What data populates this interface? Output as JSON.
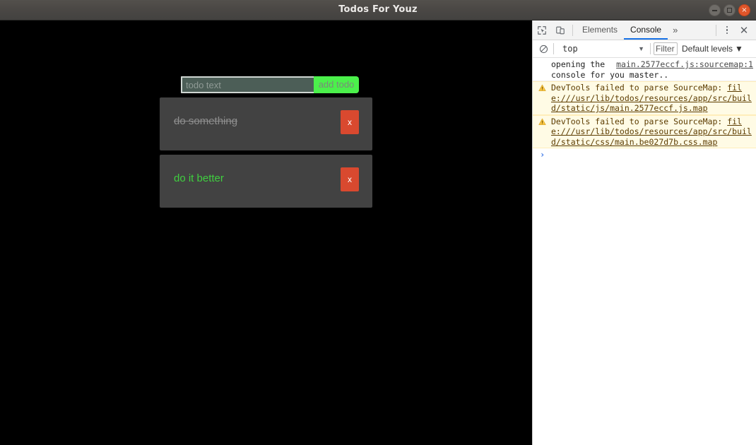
{
  "window": {
    "title": "Todos For Youz",
    "controls": {
      "minimize": "minimize-button",
      "maximize": "maximize-button",
      "close": "×"
    }
  },
  "app": {
    "input": {
      "placeholder": "todo text",
      "value": ""
    },
    "add_button_label": "add todo",
    "delete_button_label": "x",
    "todos": [
      {
        "text": "do something",
        "completed": true
      },
      {
        "text": "do it better",
        "completed": false
      }
    ],
    "colors": {
      "background": "#000000",
      "card": "#424242",
      "add_button": "#4bf04b",
      "delete_button": "#d9492f",
      "active_text": "#3fcf3f",
      "done_text": "#8e8e8e",
      "input_fill": "#4c5e57"
    }
  },
  "devtools": {
    "icons": {
      "inspect": "inspect-element-icon",
      "device": "device-toolbar-icon",
      "more_tabs": "»",
      "kebab": "more-options-icon",
      "close": "✕",
      "clear_console": "clear-console-icon"
    },
    "tabs": [
      {
        "label": "Elements",
        "active": false
      },
      {
        "label": "Console",
        "active": true
      }
    ],
    "filterbar": {
      "context": "top",
      "context_caret": "▼",
      "filter_placeholder": "Filter",
      "filter_value": "",
      "levels": "Default levels",
      "levels_caret": "▼"
    },
    "console_messages": [
      {
        "type": "log",
        "text": "opening the console for you master..",
        "source": "main.2577eccf.js:sourcemap:1"
      },
      {
        "type": "warning",
        "prefix": "DevTools failed to parse SourceMap: ",
        "url": "file:///usr/lib/todos/resources/app/src/build/static/js/main.2577eccf.js.map"
      },
      {
        "type": "warning",
        "prefix": "DevTools failed to parse SourceMap: ",
        "url": "file:///usr/lib/todos/resources/app/src/build/static/css/main.be027d7b.css.map"
      }
    ],
    "prompt": {
      "caret": "›",
      "value": ""
    },
    "colors": {
      "panel_background": "#ffffff",
      "tab_active": "#1a73e8",
      "warning_background": "#fffbe5",
      "warning_icon": "#f4b400",
      "prompt_caret": "#3b78e7"
    }
  }
}
